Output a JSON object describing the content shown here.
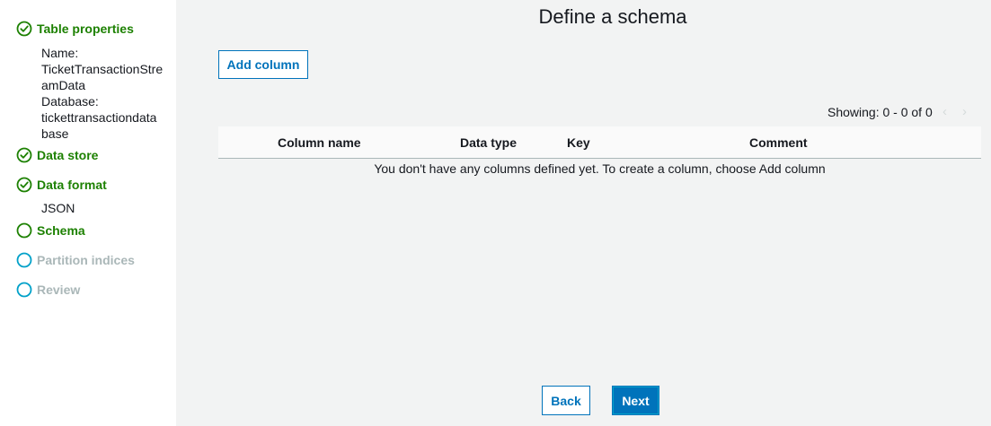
{
  "sidebar": {
    "steps": [
      {
        "label": "Table properties",
        "state": "done",
        "details": [
          "Name:",
          "TicketTransactionStre",
          "amData",
          "Database:",
          "tickettransactiondata",
          "base"
        ]
      },
      {
        "label": "Data store",
        "state": "done"
      },
      {
        "label": "Data format",
        "state": "done",
        "details": [
          "JSON"
        ]
      },
      {
        "label": "Schema",
        "state": "current"
      },
      {
        "label": "Partition indices",
        "state": "pending"
      },
      {
        "label": "Review",
        "state": "pending"
      }
    ]
  },
  "main": {
    "title": "Define a schema",
    "add_column_label": "Add column",
    "pagination": {
      "showing_text": "Showing: 0 - 0 of 0",
      "prev_glyph": "‹",
      "next_glyph": "›"
    },
    "table": {
      "columns": [
        "Column name",
        "Data type",
        "Key",
        "Comment"
      ],
      "empty_message": "You don't have any columns defined yet. To create a column, choose Add column"
    },
    "footer": {
      "back_label": "Back",
      "next_label": "Next"
    }
  },
  "colors": {
    "success": "#1d8102",
    "pending": "#00a1c9",
    "link": "#0073bb",
    "primary": "#0073bb",
    "background": "#f2f3f3"
  },
  "icons": {
    "done": "check-circle-icon",
    "current": "circle-outline-icon",
    "pending": "circle-outline-icon"
  }
}
